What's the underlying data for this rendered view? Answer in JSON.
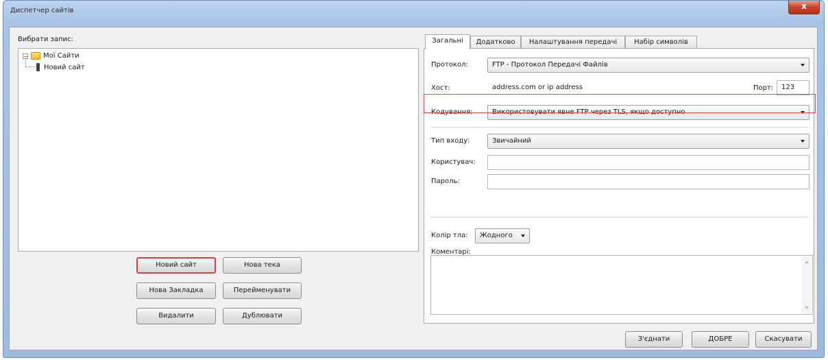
{
  "window": {
    "title": "Диспетчер сайтів",
    "close_glyph": "x"
  },
  "left": {
    "select_entry_label": "Вибрати запис:",
    "tree": {
      "root": "Мої Сайти",
      "expander": "−",
      "child": "Новий сайт"
    },
    "buttons": {
      "new_site": "Новий сайт",
      "new_folder": "Нова тека",
      "new_bookmark": "Нова Закладка",
      "rename": "Перейменувати",
      "delete": "Видалити",
      "duplicate": "Дублювати"
    }
  },
  "tabs": [
    "Загальні",
    "Додатково",
    "Налаштування передачі",
    "Набір символів"
  ],
  "general": {
    "protocol_label": "Протокол:",
    "protocol_value": "FTP - Протокол Передачі Файлів",
    "host_label": "Хост:",
    "host_value": "address.com or ip address",
    "port_label": "Порт:",
    "port_value": "123",
    "encryption_label": "Кодування:",
    "encryption_value": "Використовувати явне FTP через TLS, якщо доступно",
    "logon_type_label": "Тип входу:",
    "logon_type_value": "Звичайний",
    "user_label": "Користувач:",
    "user_value": "",
    "password_label": "Пароль:",
    "password_value": "",
    "bg_color_label": "Колір тла:",
    "bg_color_value": "Жодного",
    "comments_label": "Коментарі:"
  },
  "footer": {
    "connect": "З'єднати",
    "ok": "ДОБРЕ",
    "cancel": "Скасувати"
  },
  "colors": {
    "highlight": "#d05050",
    "title_bar": "#a9c4e6"
  }
}
